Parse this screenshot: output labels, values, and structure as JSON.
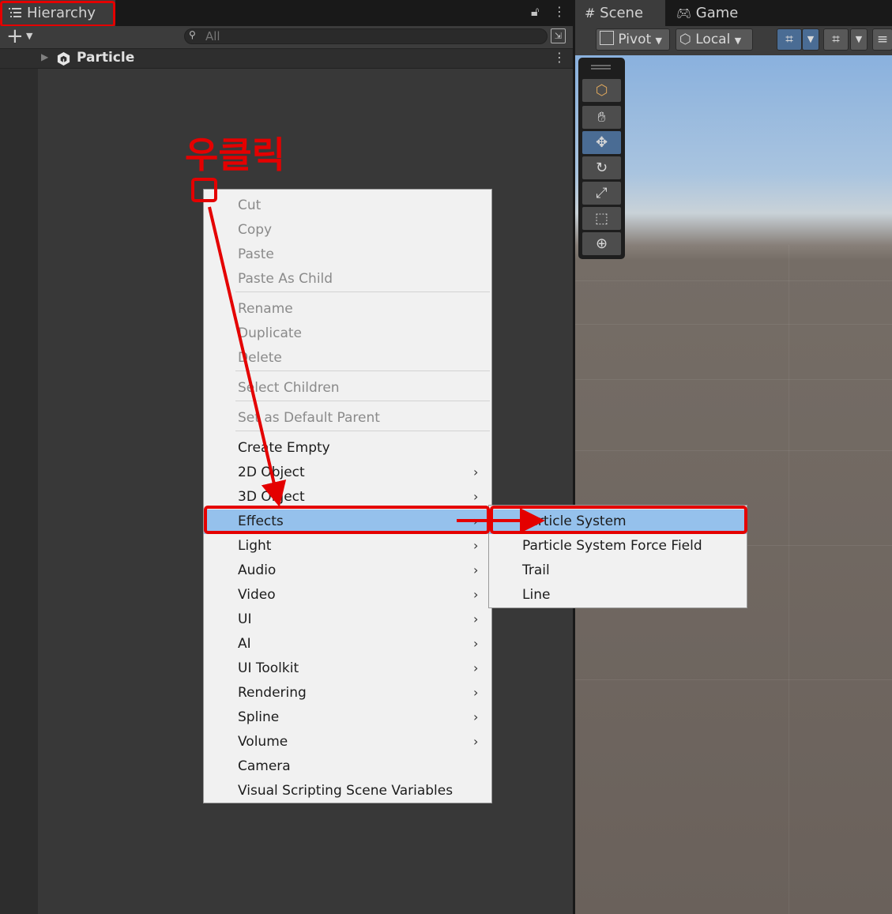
{
  "hierarchy": {
    "tab_title": "Hierarchy",
    "search_placeholder": "All",
    "scene_name": "Particle"
  },
  "scene_view": {
    "tabs": [
      "Scene",
      "Game"
    ],
    "pivot_label": "Pivot",
    "local_label": "Local"
  },
  "annotation": {
    "label": "우클릭",
    "color": "#e40000"
  },
  "context_menu": {
    "items": [
      {
        "label": "Cut",
        "enabled": false
      },
      {
        "label": "Copy",
        "enabled": false
      },
      {
        "label": "Paste",
        "enabled": false
      },
      {
        "label": "Paste As Child",
        "enabled": false
      },
      {
        "label": "Rename",
        "enabled": false
      },
      {
        "label": "Duplicate",
        "enabled": false
      },
      {
        "label": "Delete",
        "enabled": false
      },
      {
        "label": "Select Children",
        "enabled": false
      },
      {
        "label": "Set as Default Parent",
        "enabled": false
      },
      {
        "label": "Create Empty",
        "enabled": true
      },
      {
        "label": "2D Object",
        "enabled": true,
        "submenu": true
      },
      {
        "label": "3D Object",
        "enabled": true,
        "submenu": true
      },
      {
        "label": "Effects",
        "enabled": true,
        "submenu": true,
        "highlighted": true
      },
      {
        "label": "Light",
        "enabled": true,
        "submenu": true
      },
      {
        "label": "Audio",
        "enabled": true,
        "submenu": true
      },
      {
        "label": "Video",
        "enabled": true,
        "submenu": true
      },
      {
        "label": "UI",
        "enabled": true,
        "submenu": true
      },
      {
        "label": "AI",
        "enabled": true,
        "submenu": true
      },
      {
        "label": "UI Toolkit",
        "enabled": true,
        "submenu": true
      },
      {
        "label": "Rendering",
        "enabled": true,
        "submenu": true
      },
      {
        "label": "Spline",
        "enabled": true,
        "submenu": true
      },
      {
        "label": "Volume",
        "enabled": true,
        "submenu": true
      },
      {
        "label": "Camera",
        "enabled": true
      },
      {
        "label": "Visual Scripting Scene Variables",
        "enabled": true
      }
    ]
  },
  "effects_submenu": {
    "items": [
      {
        "label": "Particle System",
        "highlighted": true
      },
      {
        "label": "Particle System Force Field"
      },
      {
        "label": "Trail"
      },
      {
        "label": "Line"
      }
    ]
  },
  "colors": {
    "highlight": "#95c1ec",
    "menu_bg": "#f1f1f1",
    "panel_bg": "#383838",
    "tool_active": "#4a6c94"
  }
}
